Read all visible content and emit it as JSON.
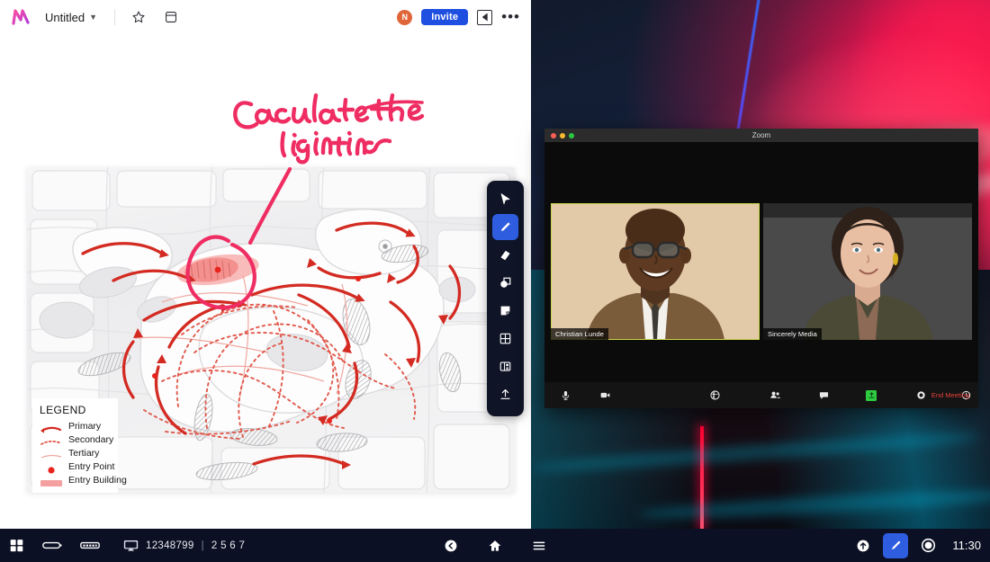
{
  "app": {
    "logo_icon": "freehand-logo",
    "title": "Untitled",
    "title_caret_icon": "chevron-down-icon",
    "star_icon": "star-icon",
    "archive_icon": "archive-box-icon",
    "avatar_initial": "N",
    "invite_label": "Invite",
    "panel_toggle_icon": "collapse-panel-icon",
    "more_icon": "more-horizontal-icon"
  },
  "annotation": {
    "line1": "Caculate the",
    "line2": "lighting"
  },
  "toolbar": {
    "items": [
      {
        "name": "select-tool",
        "icon": "cursor-arrow-icon",
        "active": false
      },
      {
        "name": "pen-tool",
        "icon": "pen-icon",
        "active": true
      },
      {
        "name": "eraser-tool",
        "icon": "eraser-icon",
        "active": false
      },
      {
        "name": "shapes-tool",
        "icon": "shapes-icon",
        "active": false
      },
      {
        "name": "sticky-note-tool",
        "icon": "sticky-note-icon",
        "active": false
      },
      {
        "name": "frame-tool",
        "icon": "frame-grid-icon",
        "active": false
      },
      {
        "name": "template-tool",
        "icon": "template-layout-icon",
        "active": false
      },
      {
        "name": "upload-tool",
        "icon": "upload-arrow-icon",
        "active": false
      }
    ]
  },
  "legend": {
    "title": "LEGEND",
    "items": [
      {
        "label": "Primary",
        "swatch": "solid-red-arrow",
        "color": "#d32b22"
      },
      {
        "label": "Secondary",
        "swatch": "dashed-red-line",
        "color": "#e05a4d"
      },
      {
        "label": "Tertiary",
        "swatch": "thin-pink-line",
        "color": "#f0a7a0"
      },
      {
        "label": "Entry Point",
        "swatch": "red-dot",
        "color": "#e8241c"
      },
      {
        "label": "Entry Building",
        "swatch": "pink-block",
        "color": "#f4a0a0"
      }
    ]
  },
  "zoom_window": {
    "title": "Zoom",
    "traffic_lights": [
      "#ff5f57",
      "#febc2e",
      "#28c840"
    ],
    "participants": [
      {
        "name": "Christian Lunde",
        "active_speaker": true
      },
      {
        "name": "Sincerely Media",
        "active_speaker": false
      }
    ],
    "controls": [
      {
        "name": "mute-button",
        "icon": "microphone-icon",
        "highlight": false
      },
      {
        "name": "stop-video-button",
        "icon": "video-camera-icon",
        "highlight": false
      },
      {
        "name": "share-button",
        "icon": "share-icon",
        "highlight": false
      },
      {
        "name": "participants-button",
        "icon": "participants-icon",
        "highlight": false
      },
      {
        "name": "chat-button",
        "icon": "chat-bubble-icon",
        "highlight": false
      },
      {
        "name": "share-screen-button",
        "icon": "share-screen-icon",
        "highlight": true
      },
      {
        "name": "record-button",
        "icon": "record-circle-icon",
        "highlight": false
      },
      {
        "name": "reactions-button",
        "icon": "reactions-icon",
        "highlight": false
      }
    ],
    "end_meeting_label": "End Meeting"
  },
  "taskbar": {
    "start_icon": "windows-start-icon",
    "pill_icon_1": "battery-pill-icon",
    "pill_icon_2": "keyboard-pill-icon",
    "monitor_icon": "monitor-icon",
    "code_primary": "12348799",
    "code_separator": "|",
    "code_secondary": "2 5 6 7",
    "back_icon": "back-circle-icon",
    "home_icon": "home-icon",
    "menu_icon": "hamburger-menu-icon",
    "up_icon": "up-arrow-circle-icon",
    "pen_icon": "pen-icon",
    "record_icon": "record-circle-icon",
    "clock": "11:30"
  },
  "colors": {
    "accent_blue": "#2f5de0",
    "annotation_pink": "#ef2d62",
    "taskbar_bg": "#0b1024",
    "toolbar_bg": "#101427"
  }
}
